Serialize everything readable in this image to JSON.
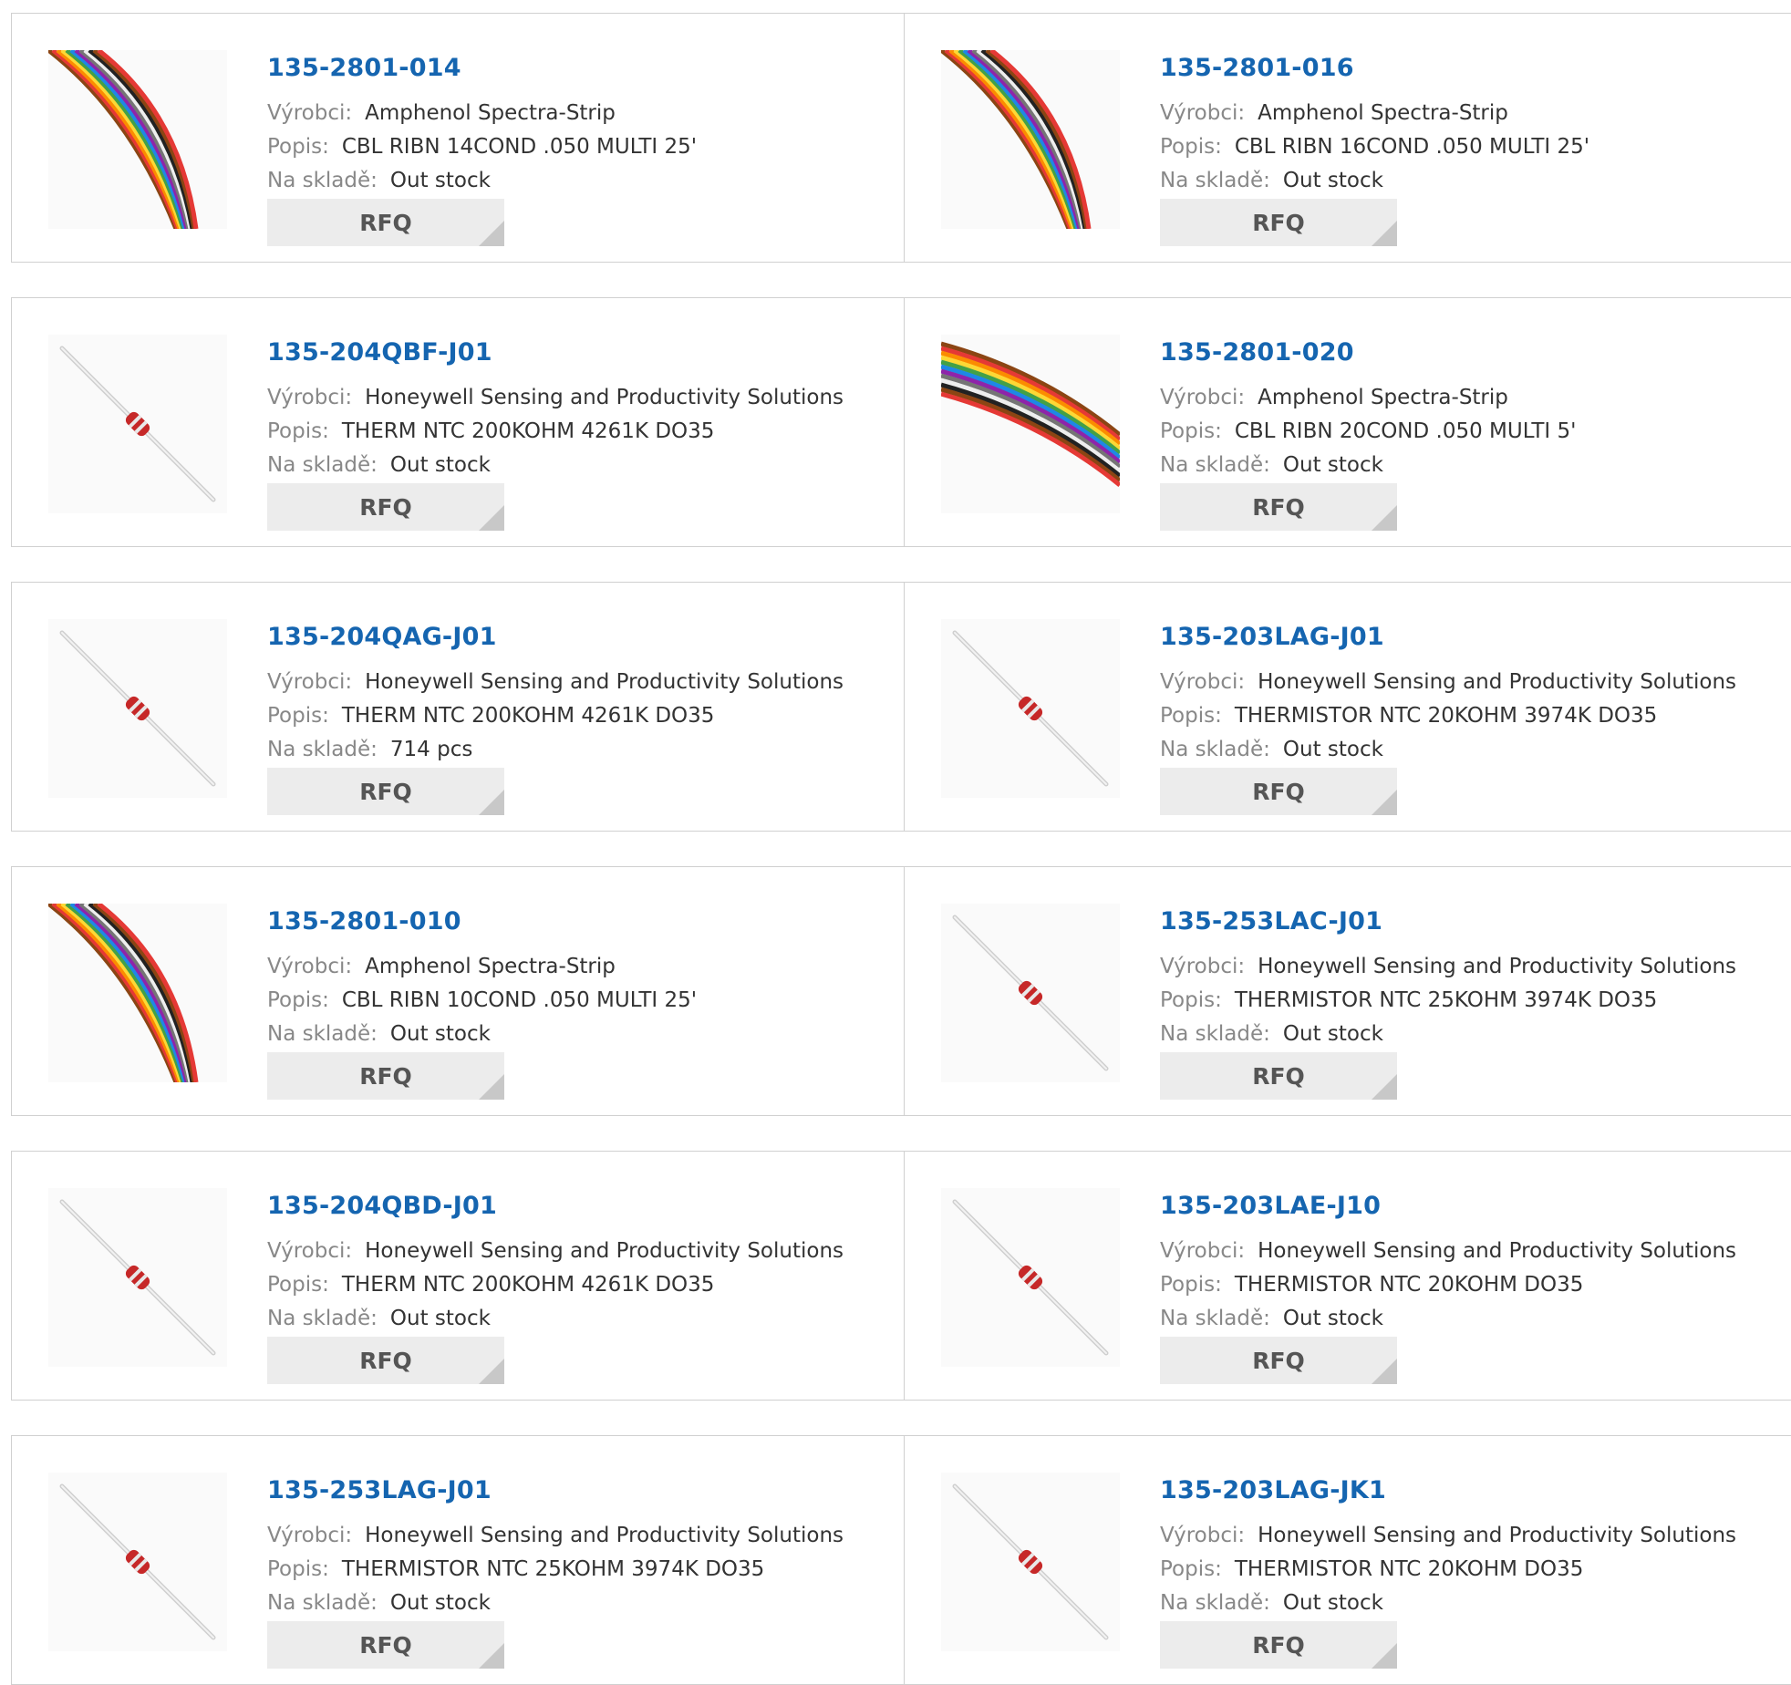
{
  "labels": {
    "manufacturer": "Výrobci:",
    "description": "Popis:",
    "stock": "Na skladě:",
    "rfq": "RFQ"
  },
  "products": [
    {
      "pn": "135-2801-014",
      "mfr": "Amphenol Spectra-Strip",
      "desc": "CBL RIBN 14COND .050 MULTI 25'",
      "stock": "Out stock",
      "image": "ribbon-cable-icon"
    },
    {
      "pn": "135-2801-016",
      "mfr": "Amphenol Spectra-Strip",
      "desc": "CBL RIBN 16COND .050 MULTI 25'",
      "stock": "Out stock",
      "image": "ribbon-cable-icon"
    },
    {
      "pn": "135-204QBF-J01",
      "mfr": "Honeywell Sensing and Productivity Solutions",
      "desc": "THERM NTC 200KOHM 4261K DO35",
      "stock": "Out stock",
      "image": "thermistor-icon"
    },
    {
      "pn": "135-2801-020",
      "mfr": "Amphenol Spectra-Strip",
      "desc": "CBL RIBN 20COND .050 MULTI 5'",
      "stock": "Out stock",
      "image": "ribbon-cable-icon"
    },
    {
      "pn": "135-204QAG-J01",
      "mfr": "Honeywell Sensing and Productivity Solutions",
      "desc": "THERM NTC 200KOHM 4261K DO35",
      "stock": "714 pcs",
      "image": "thermistor-icon"
    },
    {
      "pn": "135-203LAG-J01",
      "mfr": "Honeywell Sensing and Productivity Solutions",
      "desc": "THERMISTOR NTC 20KOHM 3974K DO35",
      "stock": "Out stock",
      "image": "thermistor-icon"
    },
    {
      "pn": "135-2801-010",
      "mfr": "Amphenol Spectra-Strip",
      "desc": "CBL RIBN 10COND .050 MULTI 25'",
      "stock": "Out stock",
      "image": "ribbon-cable-icon"
    },
    {
      "pn": "135-253LAC-J01",
      "mfr": "Honeywell Sensing and Productivity Solutions",
      "desc": "THERMISTOR NTC 25KOHM 3974K DO35",
      "stock": "Out stock",
      "image": "thermistor-icon"
    },
    {
      "pn": "135-204QBD-J01",
      "mfr": "Honeywell Sensing and Productivity Solutions",
      "desc": "THERM NTC 200KOHM 4261K DO35",
      "stock": "Out stock",
      "image": "thermistor-icon"
    },
    {
      "pn": "135-203LAE-J10",
      "mfr": "Honeywell Sensing and Productivity Solutions",
      "desc": "THERMISTOR NTC 20KOHM DO35",
      "stock": "Out stock",
      "image": "thermistor-icon"
    },
    {
      "pn": "135-253LAG-J01",
      "mfr": "Honeywell Sensing and Productivity Solutions",
      "desc": "THERMISTOR NTC 25KOHM 3974K DO35",
      "stock": "Out stock",
      "image": "thermistor-icon"
    },
    {
      "pn": "135-203LAG-JK1",
      "mfr": "Honeywell Sensing and Productivity Solutions",
      "desc": "THERMISTOR NTC 20KOHM DO35",
      "stock": "Out stock",
      "image": "thermistor-icon"
    }
  ],
  "colors": {
    "part_link": "#1565b0",
    "label": "#888888",
    "value": "#333333",
    "rfq_bg": "#ececec",
    "border": "#d0d0d0"
  }
}
